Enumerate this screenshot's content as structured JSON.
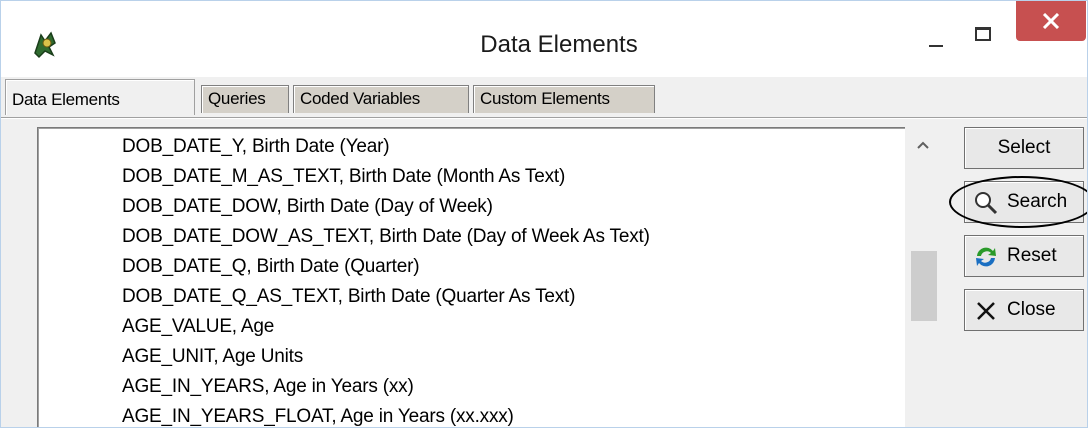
{
  "window": {
    "title": "Data Elements",
    "icons": {
      "app": "app-icon",
      "minimize": "minimize-icon",
      "maximize": "maximize-icon",
      "close": "close-x-icon"
    },
    "close_color": "#c75050"
  },
  "tabs": [
    {
      "label": "Data Elements",
      "active": true
    },
    {
      "label": "Queries",
      "active": false
    },
    {
      "label": "Coded Variables",
      "active": false
    },
    {
      "label": "Custom Elements",
      "active": false
    }
  ],
  "list": {
    "items": [
      "DOB_DATE_Y, Birth Date (Year)",
      "DOB_DATE_M_AS_TEXT, Birth Date (Month As Text)",
      "DOB_DATE_DOW, Birth Date (Day of Week)",
      "DOB_DATE_DOW_AS_TEXT, Birth Date (Day of Week As Text)",
      "DOB_DATE_Q, Birth Date (Quarter)",
      "DOB_DATE_Q_AS_TEXT, Birth Date (Quarter As Text)",
      "AGE_VALUE, Age",
      "AGE_UNIT, Age Units",
      "AGE_IN_YEARS, Age in Years (xx)",
      "AGE_IN_YEARS_FLOAT, Age in Years (xx.xxx)"
    ]
  },
  "buttons": {
    "select": {
      "label": "Select"
    },
    "search": {
      "label": "Search",
      "icon": "magnifier-icon"
    },
    "reset": {
      "label": "Reset",
      "icon": "refresh-icon"
    },
    "close": {
      "label": "Close",
      "icon": "x-icon"
    }
  }
}
